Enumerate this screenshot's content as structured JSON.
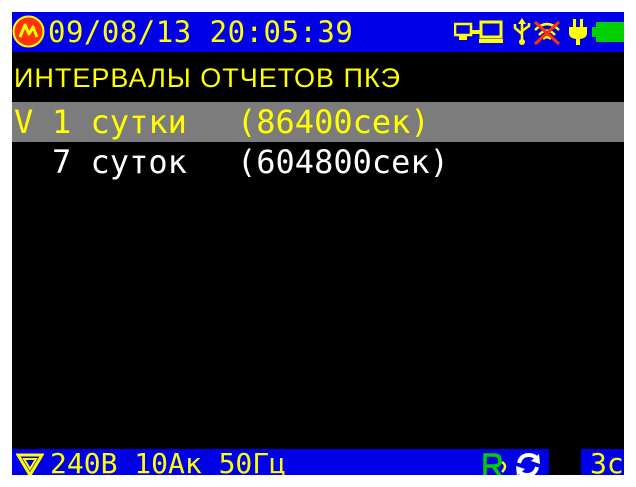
{
  "status_bar": {
    "datetime": "09/08/13 20:05:39",
    "icons": [
      "logo-icon",
      "usb-icon",
      "pc-icon",
      "usb-symbol-icon",
      "no-connection-icon",
      "power-plug-icon",
      "battery-icon"
    ],
    "colors": {
      "bar": "#0000e8",
      "text": "#ffff00",
      "logo": "#ff3300",
      "battery": "#00d000",
      "no_conn": "#ff3300"
    }
  },
  "screen": {
    "title": "ИНТЕРВАЛЫ ОТЧЕТОВ ПКЭ",
    "items": [
      {
        "mark": "V",
        "label": "1 сутки",
        "value": "(86400сек)",
        "selected": true
      },
      {
        "mark": "",
        "label": "7 суток",
        "value": "(604800сек)",
        "selected": false
      }
    ]
  },
  "bottom_bar": {
    "settings": "240В 10Ак 50Гц",
    "right_text": "3с",
    "icons": [
      "filter-icon",
      "recording-icon",
      "sync-icon"
    ],
    "colors": {
      "rec": "#00d000",
      "sync": "#ffffff"
    }
  }
}
